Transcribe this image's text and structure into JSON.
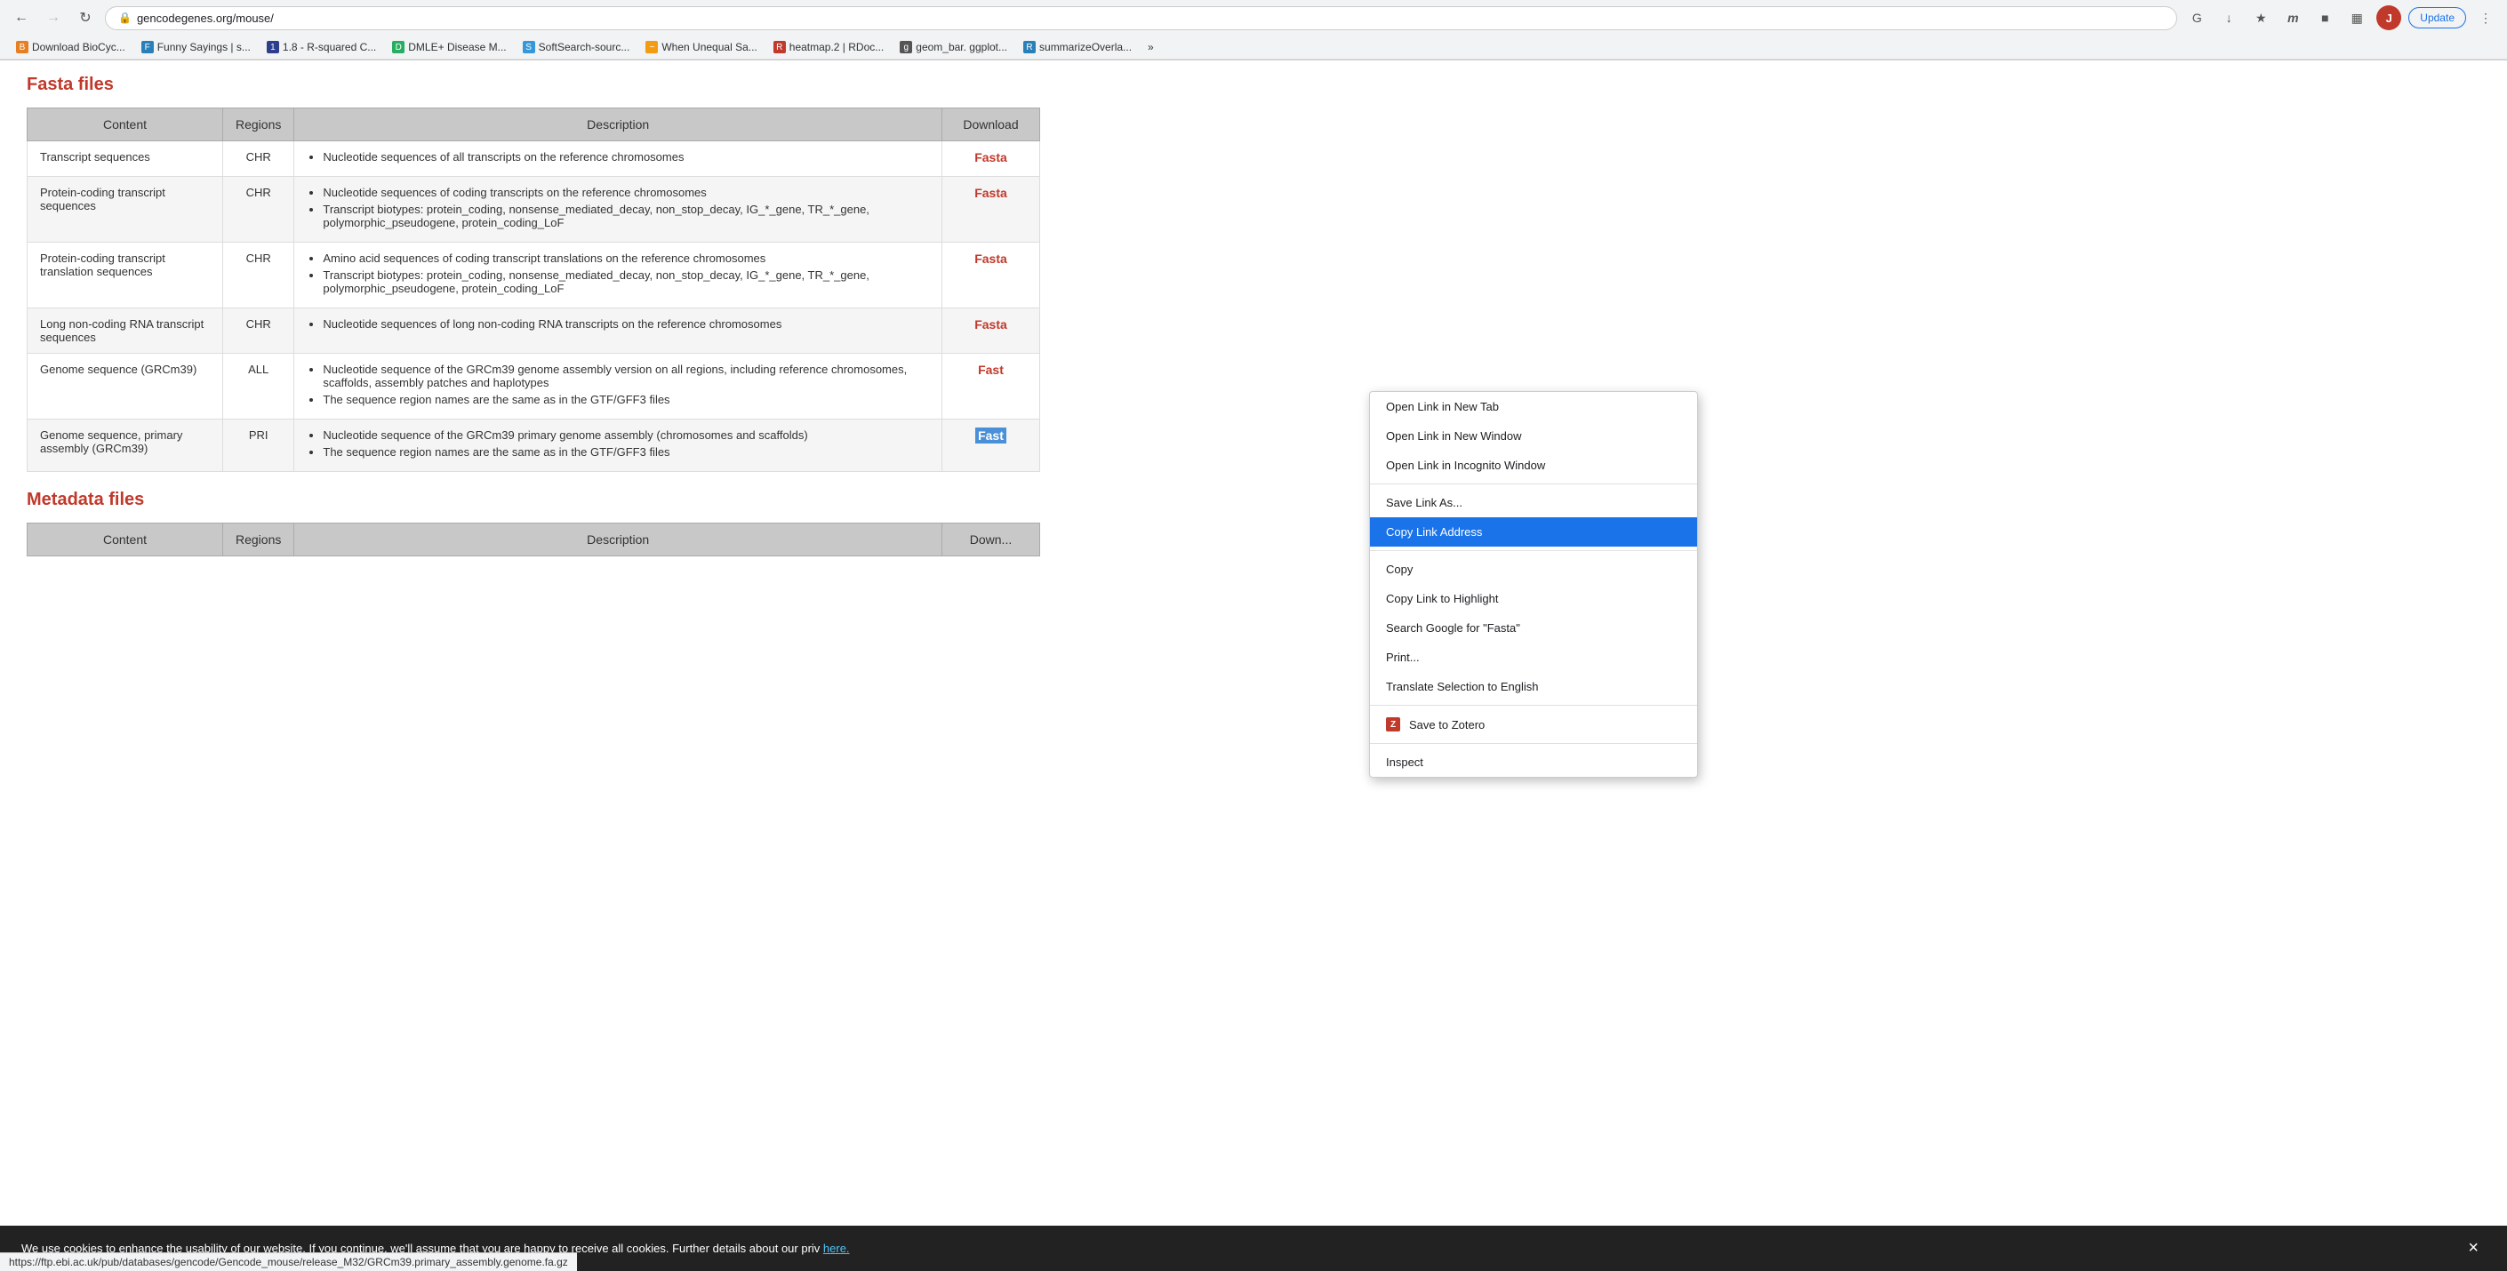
{
  "browser": {
    "url": "gencodegenes.org/mouse/",
    "back_disabled": false,
    "forward_disabled": true,
    "update_label": "Update",
    "profile_initial": "J"
  },
  "bookmarks": [
    {
      "id": "bm1",
      "label": "Download BioCyc...",
      "favicon_class": "bm-orange",
      "initial": "B"
    },
    {
      "id": "bm2",
      "label": "Funny Sayings | s...",
      "favicon_class": "bm-blue",
      "initial": "F"
    },
    {
      "id": "bm3",
      "label": "1.8 - R-squared C...",
      "favicon_class": "bm-darkblue",
      "initial": "1"
    },
    {
      "id": "bm4",
      "label": "DMLE+ Disease M...",
      "favicon_class": "bm-teal",
      "initial": "D"
    },
    {
      "id": "bm5",
      "label": "SoftSearch-sourc...",
      "favicon_class": "bm-lblue",
      "initial": "S"
    },
    {
      "id": "bm6",
      "label": "When Unequal Sa...",
      "favicon_class": "bm-wavy",
      "initial": "W"
    },
    {
      "id": "bm7",
      "label": "heatmap.2 | RDoc...",
      "favicon_class": "bm-red",
      "initial": "R"
    },
    {
      "id": "bm8",
      "label": "geom_bar. ggplot...",
      "favicon_class": "bm-globe",
      "initial": "g"
    },
    {
      "id": "bm9",
      "label": "summarizeOverla...",
      "favicon_class": "bm-r",
      "initial": "R"
    }
  ],
  "page": {
    "fasta_section_title": "Fasta files",
    "metadata_section_title": "Metadata files",
    "table_headers": {
      "content": "Content",
      "regions": "Regions",
      "description": "Description",
      "download": "Download"
    },
    "fasta_rows": [
      {
        "content": "Transcript sequences",
        "regions": "CHR",
        "description_items": [
          "Nucleotide sequences of all transcripts on the reference chromosomes"
        ],
        "download": "Fasta",
        "download_style": "red"
      },
      {
        "content": "Protein-coding transcript sequences",
        "regions": "CHR",
        "description_items": [
          "Nucleotide sequences of coding transcripts on the reference chromosomes",
          "Transcript biotypes: protein_coding, nonsense_mediated_decay, non_stop_decay, IG_*_gene, TR_*_gene, polymorphic_pseudogene, protein_coding_LoF"
        ],
        "download": "Fasta",
        "download_style": "red"
      },
      {
        "content": "Protein-coding transcript translation sequences",
        "regions": "CHR",
        "description_items": [
          "Amino acid sequences of coding transcript translations on the reference chromosomes",
          "Transcript biotypes: protein_coding, nonsense_mediated_decay, non_stop_decay, IG_*_gene, TR_*_gene, polymorphic_pseudogene, protein_coding_LoF"
        ],
        "download": "Fasta",
        "download_style": "red"
      },
      {
        "content": "Long non-coding RNA transcript sequences",
        "regions": "CHR",
        "description_items": [
          "Nucleotide sequences of long non-coding RNA transcripts on the reference chromosomes"
        ],
        "download": "Fasta",
        "download_style": "red"
      },
      {
        "content": "Genome sequence (GRCm39)",
        "regions": "ALL",
        "description_items": [
          "Nucleotide sequence of the GRCm39 genome assembly version on all regions, including reference chromosomes, scaffolds, assembly patches and haplotypes",
          "The sequence region names are the same as in the GTF/GFF3 files"
        ],
        "download": "Fasta",
        "download_style": "partial"
      },
      {
        "content": "Genome sequence, primary assembly (GRCm39)",
        "regions": "PRI",
        "description_items": [
          "Nucleotide sequence of the GRCm39 primary genome assembly (chromosomes and scaffolds)",
          "The sequence region names are the same as in the GTF/GFF3 files"
        ],
        "download": "Fasta",
        "download_style": "blue"
      }
    ],
    "bottom_table_headers": {
      "content": "Content",
      "regions": "Regions",
      "description": "Description",
      "download": "Down..."
    }
  },
  "context_menu": {
    "items": [
      {
        "id": "open-new-tab",
        "label": "Open Link in New Tab",
        "highlighted": false,
        "has_icon": false
      },
      {
        "id": "open-new-window",
        "label": "Open Link in New Window",
        "highlighted": false,
        "has_icon": false
      },
      {
        "id": "open-incognito",
        "label": "Open Link in Incognito Window",
        "highlighted": false,
        "has_icon": false
      },
      {
        "id": "divider1",
        "type": "divider"
      },
      {
        "id": "save-link",
        "label": "Save Link As...",
        "highlighted": false,
        "has_icon": false
      },
      {
        "id": "copy-link",
        "label": "Copy Link Address",
        "highlighted": true,
        "has_icon": false
      },
      {
        "id": "divider2",
        "type": "divider"
      },
      {
        "id": "copy",
        "label": "Copy",
        "highlighted": false,
        "has_icon": false
      },
      {
        "id": "copy-highlight",
        "label": "Copy Link to Highlight",
        "highlighted": false,
        "has_icon": false
      },
      {
        "id": "search-google",
        "label": "Search Google for “Fasta”",
        "highlighted": false,
        "has_icon": false
      },
      {
        "id": "print",
        "label": "Print...",
        "highlighted": false,
        "has_icon": false
      },
      {
        "id": "translate",
        "label": "Translate Selection to English",
        "highlighted": false,
        "has_icon": false
      },
      {
        "id": "divider3",
        "type": "divider"
      },
      {
        "id": "save-zotero",
        "label": "Save to Zotero",
        "highlighted": false,
        "has_icon": true,
        "icon_type": "zotero"
      },
      {
        "id": "divider4",
        "type": "divider"
      },
      {
        "id": "inspect",
        "label": "Inspect",
        "highlighted": false,
        "has_icon": false
      }
    ]
  },
  "cookie_banner": {
    "text": "We use cookies to enhance the usability of our website. If you continue, we’ll assume that you are happy to receive all cookies. Further details about our priv",
    "link_text": "here.",
    "close_label": "×"
  },
  "status_bar": {
    "url": "https://ftp.ebi.ac.uk/pub/databases/gencode/Gencode_mouse/release_M32/GRCm39.primary_assembly.genome.fa.gz"
  }
}
